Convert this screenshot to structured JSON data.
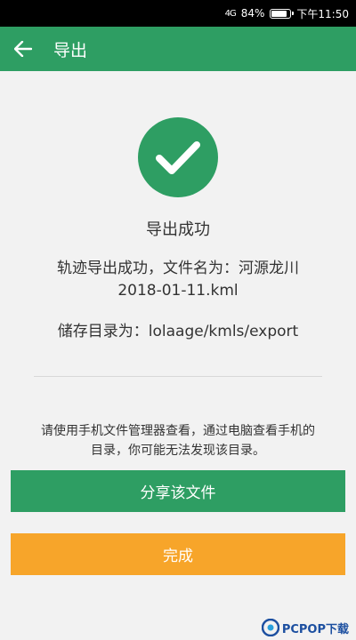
{
  "status_bar": {
    "network": "4G",
    "battery": "84%",
    "time": "下午11:50"
  },
  "app_bar": {
    "title": "导出",
    "back_icon": "arrow-left-icon"
  },
  "result": {
    "icon": "check-circle-icon",
    "title": "导出成功",
    "file_line1": "轨迹导出成功，文件名为：河源龙川",
    "file_line2": "2018-01-11.kml",
    "directory": "储存目录为：lolaage/kmls/export"
  },
  "hint": {
    "line1": "请使用手机文件管理器查看，通过电脑查看手机的",
    "line2": "目录，你可能无法发现该目录。"
  },
  "buttons": {
    "share": "分享该文件",
    "done": "完成"
  },
  "colors": {
    "primary": "#2e9e63",
    "done": "#f7a52a",
    "background": "#f2f2f2"
  }
}
